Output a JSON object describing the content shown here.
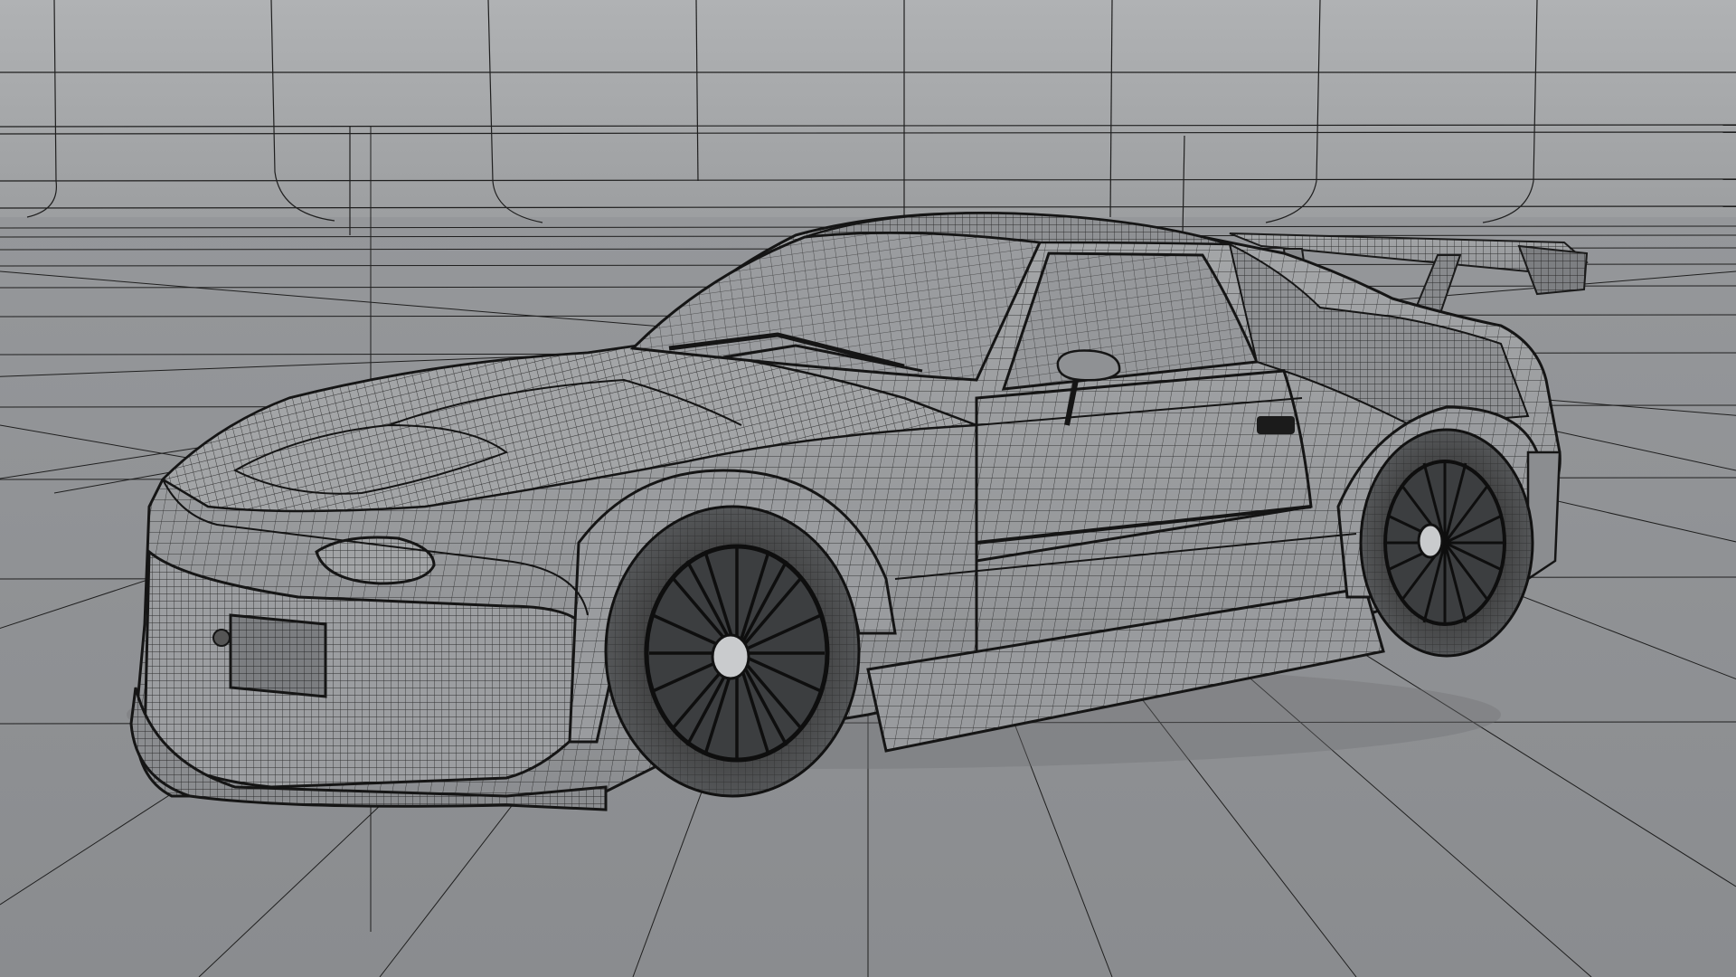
{
  "viewport": {
    "render_mode": "wireframe-on-shaded",
    "subject": "sports-car-model",
    "colors": {
      "backdrop_wall": "#a7a9ab",
      "backdrop_floor": "#8f9194",
      "mesh_surface": "#9b9d9f",
      "mesh_surface_dark": "#7e8083",
      "wire": "#1b1b1b",
      "tire": "#2a2a2a",
      "wheel_spokes": "#111111"
    }
  }
}
